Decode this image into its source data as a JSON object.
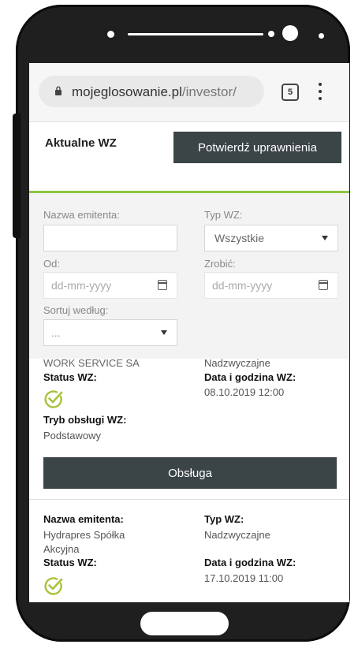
{
  "browser": {
    "url_domain": "mojeglosowanie.pl",
    "url_path": "/investor/",
    "tab_count": "5"
  },
  "header": {
    "title": "Aktualne WZ",
    "confirm_button": "Potwierdź uprawnienia"
  },
  "filters": {
    "issuer_label": "Nazwa emitenta:",
    "issuer_value": "",
    "type_label": "Typ WZ:",
    "type_value": "Wszystkie",
    "from_label": "Od:",
    "from_placeholder": "dd-mm-yyyy",
    "to_label": "Zrobić:",
    "to_placeholder": "dd-mm-yyyy",
    "sort_label": "Sortuj według:",
    "sort_value": "..."
  },
  "cards": [
    {
      "issuer_name": "WORK SERVICE SA",
      "type_value": "Nadzwyczajne",
      "status_label": "Status WZ:",
      "date_label": "Data i godzina WZ:",
      "date_value": "08.10.2019 12:00",
      "mode_label": "Tryb obsługi WZ:",
      "mode_value": "Podstawowy",
      "action_button": "Obsługa"
    },
    {
      "issuer_label": "Nazwa emitenta:",
      "issuer_name_line1": "Hydrapres Spółka",
      "issuer_name_line2": "Akcyjna",
      "type_label": "Typ WZ:",
      "type_value": "Nadzwyczajne",
      "status_label": "Status WZ:",
      "date_label": "Data i godzina WZ:",
      "date_value": "17.10.2019 11:00"
    }
  ],
  "colors": {
    "accent_green": "#8dc63f",
    "button_dark": "#3b4447"
  }
}
